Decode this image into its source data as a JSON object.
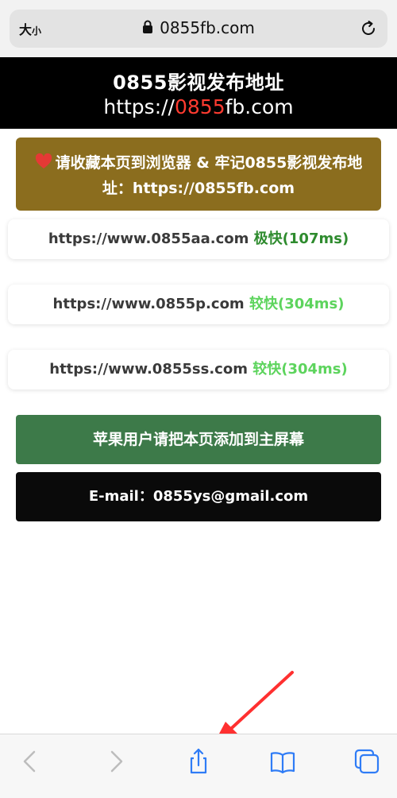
{
  "browser": {
    "text_size_label_big": "大",
    "text_size_label_small": "小",
    "url": "0855fb.com",
    "icons": {
      "lock": "lock-icon",
      "reload": "reload-icon"
    }
  },
  "header": {
    "title": "0855影视发布地址",
    "url_prefix": "https://",
    "url_highlight": "0855",
    "url_suffix": "fb.com"
  },
  "bookmark": {
    "icon": "heart-icon",
    "text": "请收藏本页到浏览器 & 牢记0855影视发布地址：https://0855fb.com"
  },
  "links": [
    {
      "url": "https://www.0855aa.com",
      "speed": "极快(107ms)",
      "speed_color": "#2e8b2e"
    },
    {
      "url": "https://www.0855p.com",
      "speed": "较快(304ms)",
      "speed_color": "#5dd45d"
    },
    {
      "url": "https://www.0855ss.com",
      "speed": "较快(304ms)",
      "speed_color": "#5dd45d"
    }
  ],
  "apple_button": {
    "label": "苹果用户请把本页添加到主屏幕",
    "color": "#3d7a49"
  },
  "email_button": {
    "label": "E-mail：0855ys@gmail.com",
    "color": "#0a0a0a"
  },
  "toolbar": {
    "icons": [
      "back-icon",
      "forward-icon",
      "share-icon",
      "bookmarks-icon",
      "tabs-icon"
    ]
  },
  "annotation": {
    "color": "#ff3030"
  }
}
